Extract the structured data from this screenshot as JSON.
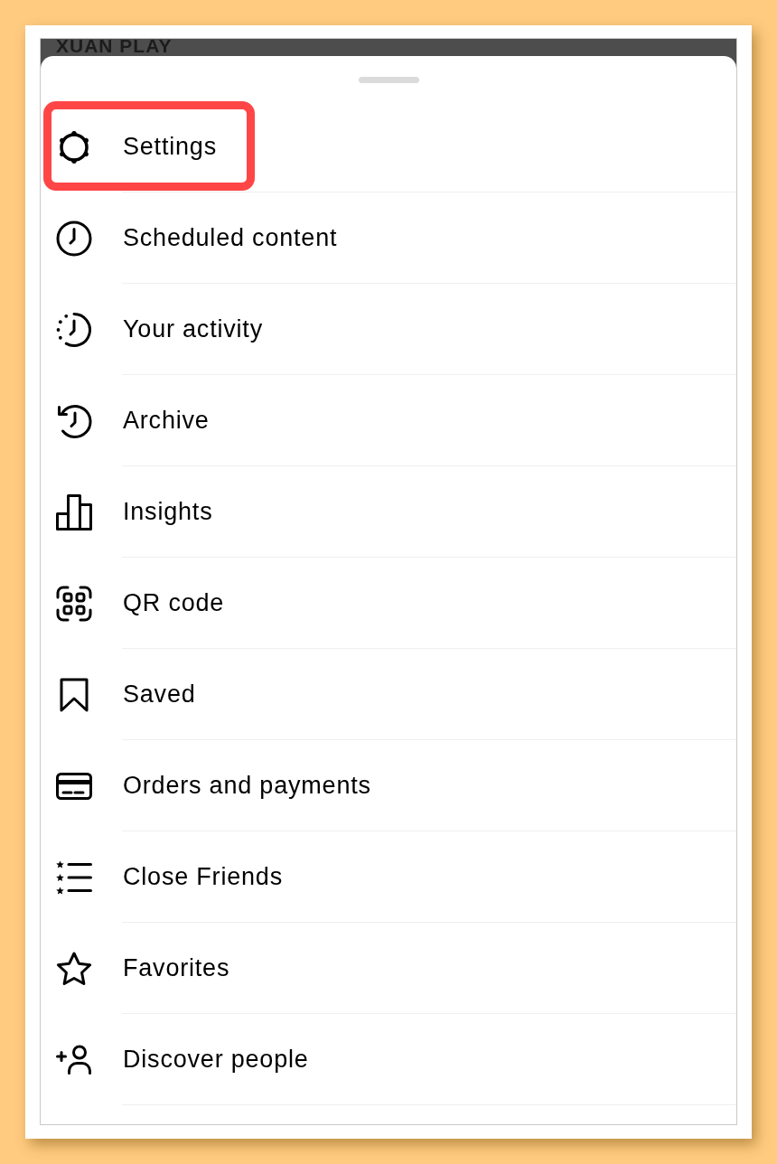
{
  "background_page": {
    "title": "XUAN PLAY"
  },
  "menu": {
    "items": [
      {
        "label": "Settings",
        "highlighted": true
      },
      {
        "label": "Scheduled content",
        "highlighted": false
      },
      {
        "label": "Your activity",
        "highlighted": false
      },
      {
        "label": "Archive",
        "highlighted": false
      },
      {
        "label": "Insights",
        "highlighted": false
      },
      {
        "label": "QR code",
        "highlighted": false
      },
      {
        "label": "Saved",
        "highlighted": false
      },
      {
        "label": "Orders and payments",
        "highlighted": false
      },
      {
        "label": "Close Friends",
        "highlighted": false
      },
      {
        "label": "Favorites",
        "highlighted": false
      },
      {
        "label": "Discover people",
        "highlighted": false
      }
    ]
  }
}
